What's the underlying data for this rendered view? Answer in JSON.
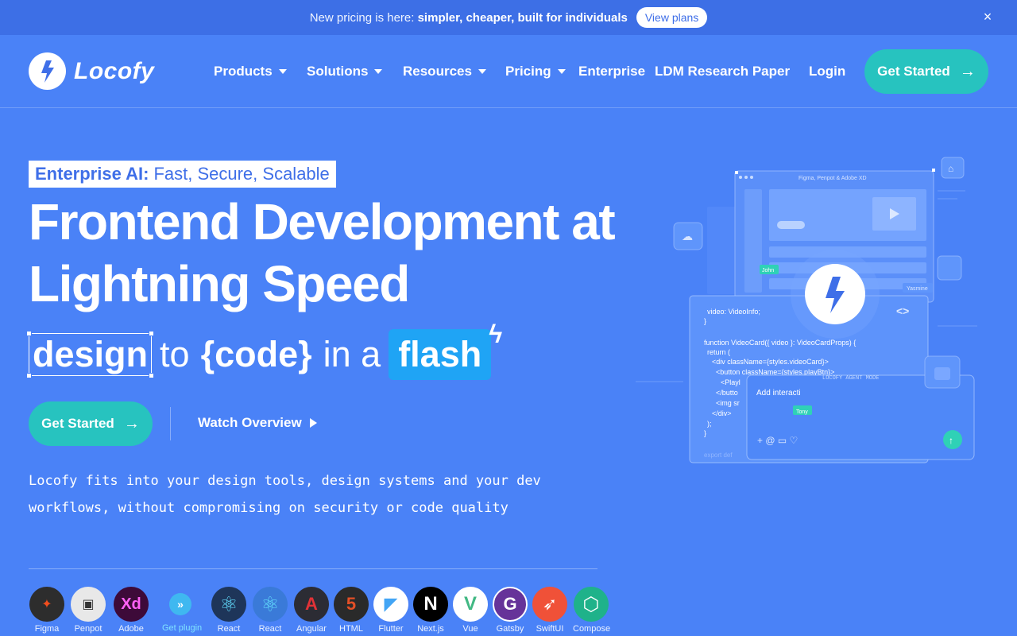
{
  "announcement": {
    "text": "New pricing is here:",
    "bold": "simpler, cheaper, built for individuals",
    "button": "View plans",
    "close": "×"
  },
  "nav": {
    "brand": "Locofy",
    "items": [
      {
        "label": "Products",
        "dropdown": true
      },
      {
        "label": "Solutions",
        "dropdown": true
      },
      {
        "label": "Resources",
        "dropdown": true
      },
      {
        "label": "Pricing",
        "dropdown": true
      },
      {
        "label": "Enterprise",
        "dropdown": false
      },
      {
        "label": "LDM Research Paper",
        "dropdown": false
      }
    ],
    "login": "Login",
    "cta": "Get Started"
  },
  "hero": {
    "badge_bold": "Enterprise AI:",
    "badge_rest": "Fast, Secure, Scalable",
    "title_line1": "Frontend Development at",
    "title_line2": "Lightning Speed",
    "tag_design": "design",
    "tag_to": "to",
    "tag_code": "{code}",
    "tag_in_a": "in a",
    "tag_flash": "flash",
    "cta": "Get Started",
    "watch": "Watch Overview",
    "description": "Locofy fits into your design tools, design systems and your dev workflows, without compromising on security or code quality"
  },
  "illustration": {
    "window_title": "Figma, Penpot & Adobe XD",
    "user1": "John",
    "user2": "Yasmine",
    "user3": "Tony",
    "code_lines": [
      "video: VideoInfo;",
      "}",
      "",
      "function VideoCard({ video }: VideoCardProps) {",
      "  return (",
      "    <div className={styles.videoCard}>",
      "      <button className={styles.playBtn}>",
      "        <Playl",
      "      </butto",
      "      <img sr",
      "    </div>",
      "  );",
      "}"
    ],
    "agent_mode": "LOCOFY AGENT MODE",
    "agent_input": "Add interacti",
    "export_hint": "export def"
  },
  "tools": [
    {
      "label": "Figma",
      "icon": "figma-icon",
      "bg": "#2d2d2d",
      "glyph": "✦"
    },
    {
      "label": "Penpot",
      "icon": "penpot-icon",
      "bg": "#e8e8e8",
      "glyph": "▣"
    },
    {
      "label": "Adobe",
      "icon": "adobe-xd-icon",
      "bg": "#3d0a39",
      "glyph": "Xd"
    },
    {
      "label": "Get plugin",
      "icon": "get-plugin-icon",
      "bg": "#3fb8f0",
      "glyph": "»"
    },
    {
      "label": "React",
      "icon": "react-icon",
      "bg": "#1e3559",
      "glyph": "⚛"
    },
    {
      "label": "React",
      "icon": "react-native-icon",
      "bg": "#3a7ad8",
      "glyph": "⚛"
    },
    {
      "label": "Angular",
      "icon": "angular-icon",
      "bg": "#2c2c34",
      "glyph": "A"
    },
    {
      "label": "HTML",
      "icon": "html-icon",
      "bg": "#2a2a2a",
      "glyph": "5"
    },
    {
      "label": "Flutter",
      "icon": "flutter-icon",
      "bg": "#ffffff",
      "glyph": "◤"
    },
    {
      "label": "Next.js",
      "icon": "nextjs-icon",
      "bg": "#000000",
      "glyph": "N"
    },
    {
      "label": "Vue",
      "icon": "vue-icon",
      "bg": "#ffffff",
      "glyph": "V"
    },
    {
      "label": "Gatsby",
      "icon": "gatsby-icon",
      "bg": "#663399",
      "glyph": "G"
    },
    {
      "label": "SwiftUI",
      "icon": "swiftui-icon",
      "bg": "#f05138",
      "glyph": "➶"
    },
    {
      "label": "Compose",
      "icon": "compose-icon",
      "bg": "#1fb28a",
      "glyph": "⬡"
    }
  ],
  "colors": {
    "background": "#4a82f7",
    "banner": "#3d6fe6",
    "accent": "#27c3bf",
    "flash": "#1fa4f5"
  }
}
